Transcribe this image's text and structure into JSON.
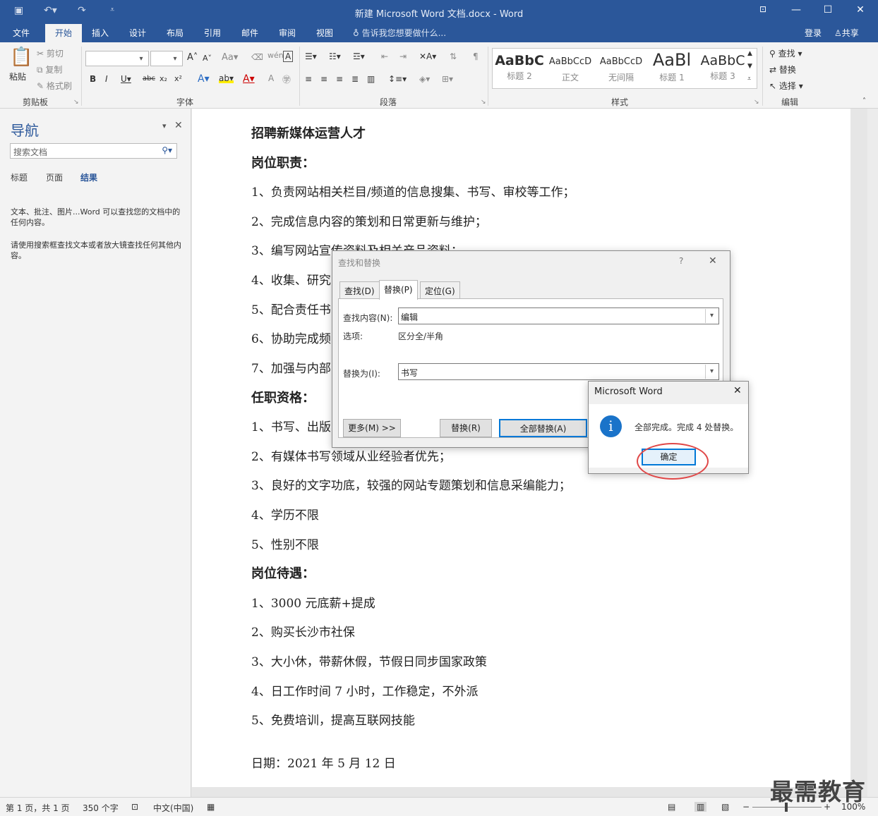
{
  "window": {
    "title": "新建 Microsoft Word 文档.docx - Word"
  },
  "tabs": [
    "文件",
    "开始",
    "插入",
    "设计",
    "布局",
    "引用",
    "邮件",
    "审阅",
    "视图"
  ],
  "tell_me": "告诉我您想要做什么...",
  "account": {
    "login": "登录",
    "share": "共享"
  },
  "ribbon": {
    "clipboard": {
      "paste": "粘贴",
      "cut": "剪切",
      "copy": "复制",
      "format_painter": "格式刷",
      "label": "剪贴板"
    },
    "font": {
      "label": "字体"
    },
    "paragraph": {
      "label": "段落"
    },
    "styles": {
      "label": "样式",
      "items": [
        {
          "preview": "AaBbC",
          "name": "标题 2"
        },
        {
          "preview": "AaBbCcD",
          "name": "正文"
        },
        {
          "preview": "AaBbCcD",
          "name": "无间隔"
        },
        {
          "preview": "AaBl",
          "name": "标题 1"
        },
        {
          "preview": "AaBbC",
          "name": "标题 3"
        }
      ]
    },
    "editing": {
      "find": "查找",
      "replace": "替换",
      "select": "选择",
      "label": "编辑"
    }
  },
  "nav": {
    "title": "导航",
    "search_placeholder": "搜索文档",
    "tabs": [
      "标题",
      "页面",
      "结果"
    ],
    "msg1": "文本、批注、图片...Word 可以查找您的文档中的任何内容。",
    "msg2": "请使用搜索框查找文本或者放大镜查找任何其他内容。"
  },
  "document": {
    "lines": [
      {
        "text": "招聘新媒体运营人才",
        "bold": true
      },
      {
        "text": "岗位职责：",
        "bold": true
      },
      {
        "text": "1、负责网站相关栏目/频道的信息搜集、书写、审校等工作；"
      },
      {
        "text": "2、完成信息内容的策划和日常更新与维护；"
      },
      {
        "text": "3、编写网站宣传资料及相关产品资料；"
      },
      {
        "text": "4、收集、研究"
      },
      {
        "text": "5、配合责任书"
      },
      {
        "text": "6、协助完成频"
      },
      {
        "text": "7、加强与内部"
      },
      {
        "text": "任职资格：",
        "bold": true
      },
      {
        "text": "1、书写、出版"
      },
      {
        "text": "2、有媒体书写领域从业经验者优先；"
      },
      {
        "text": "3、良好的文字功底，较强的网站专题策划和信息采编能力；"
      },
      {
        "text": "4、学历不限"
      },
      {
        "text": "5、性别不限"
      },
      {
        "text": "岗位待遇：",
        "bold": true
      },
      {
        "text": "1、3000 元底薪+提成"
      },
      {
        "text": "2、购买长沙市社保"
      },
      {
        "text": "3、大小休，带薪休假，节假日同步国家政策"
      },
      {
        "text": "4、日工作时间 7 小时，工作稳定，不外派"
      },
      {
        "text": "5、免费培训，提高互联网技能"
      },
      {
        "text": "日期：2021 年 5 月 12 日"
      }
    ]
  },
  "find_dialog": {
    "title": "查找和替换",
    "help": "?",
    "tabs": [
      "查找(D)",
      "替换(P)",
      "定位(G)"
    ],
    "find_label": "查找内容(N):",
    "find_value": "编辑",
    "options_label": "选项:",
    "options_value": "区分全/半角",
    "replace_label": "替换为(I):",
    "replace_value": "书写",
    "more_button": "更多(M) >>",
    "replace_button": "替换(R)",
    "replace_all_button": "全部替换(A)"
  },
  "message_box": {
    "title": "Microsoft Word",
    "text": "全部完成。完成 4 处替换。",
    "ok": "确定"
  },
  "status": {
    "page": "第 1 页，共 1 页",
    "words": "350 个字",
    "lang": "中文(中国)",
    "zoom": "100%"
  },
  "watermark": "最需教育"
}
